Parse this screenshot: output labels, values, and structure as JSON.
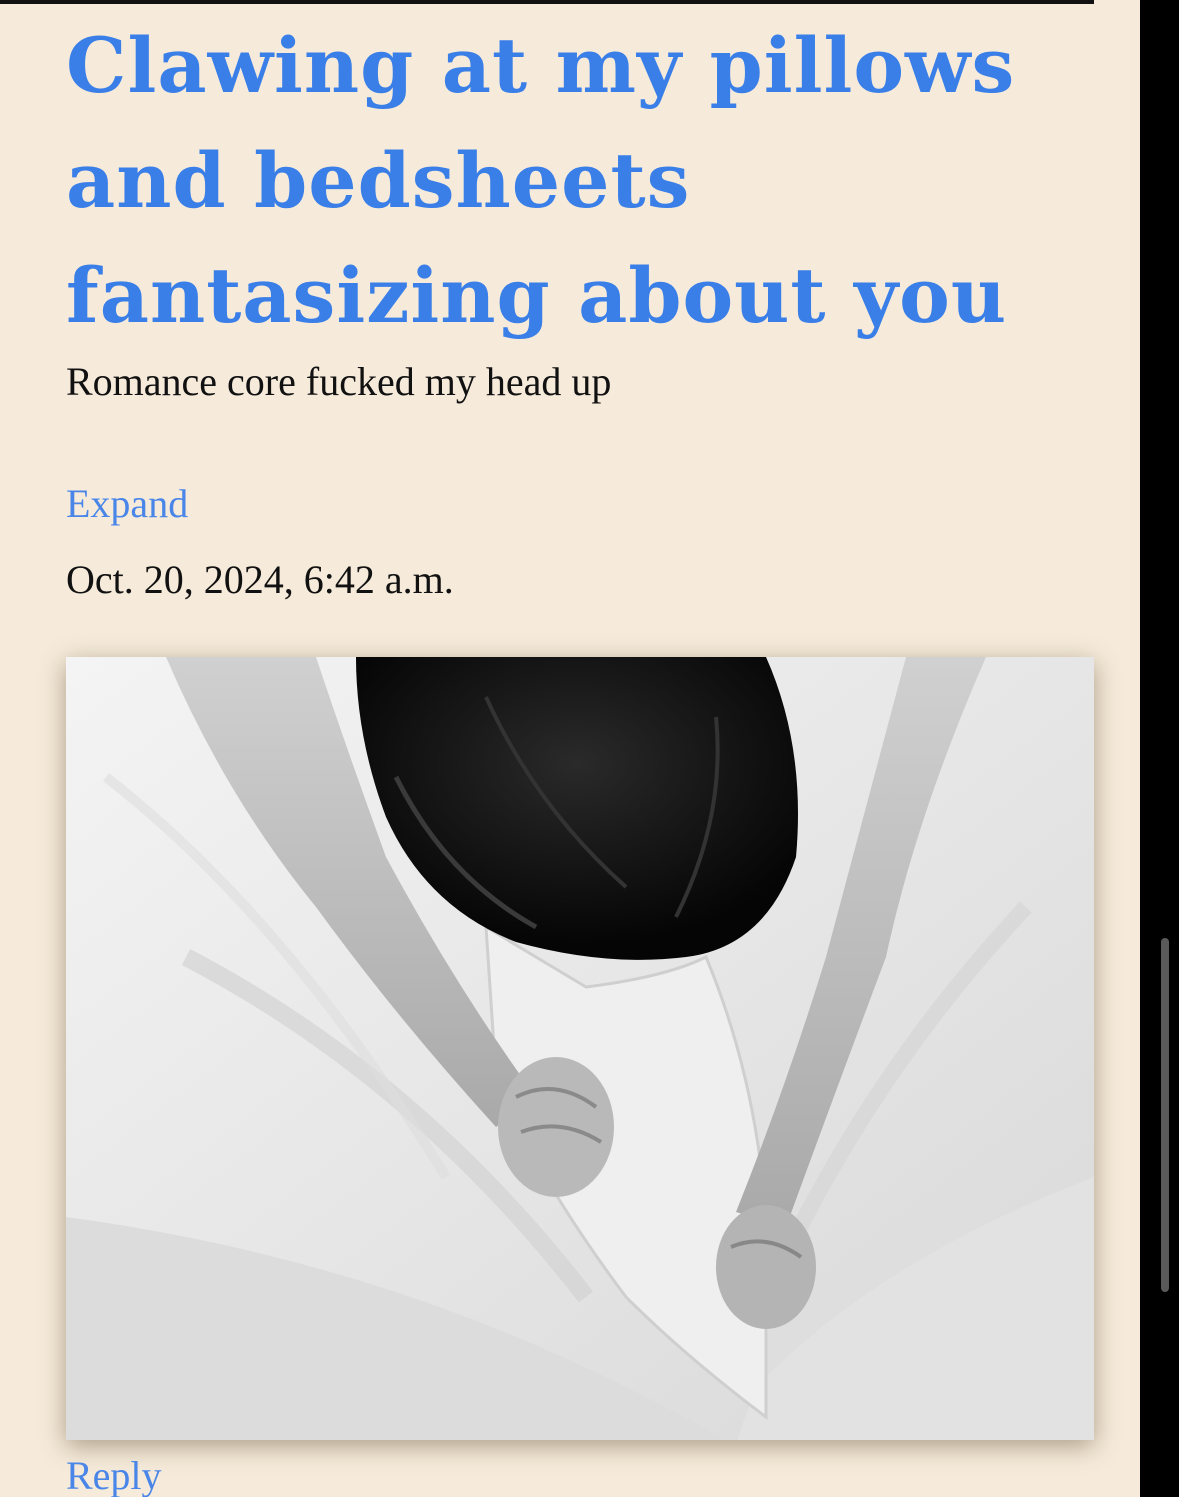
{
  "post": {
    "title": "Clawing at my pillows and bedsheets fantasizing about you",
    "subtitle": "Romance core fucked my head up",
    "expand_label": "Expand",
    "date": "Oct. 20, 2024, 6:42 a.m.",
    "reply_label": "Reply"
  },
  "colors": {
    "background": "#f6ebdb",
    "link": "#4a86e8",
    "title": "#3a7fe8",
    "text": "#111111"
  }
}
